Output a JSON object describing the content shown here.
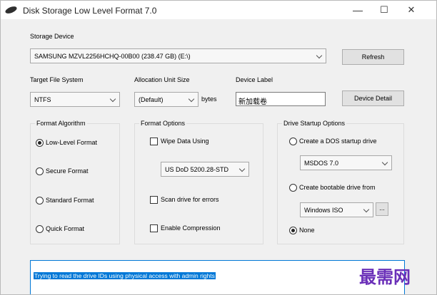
{
  "window": {
    "title": "Disk Storage Low Level Format 7.0",
    "minimize_glyph": "—",
    "maximize_glyph": "☐",
    "close_glyph": "✕",
    "app_icon": "disk-icon"
  },
  "storage": {
    "label": "Storage Device",
    "device_value": "SAMSUNG MZVL2256HCHQ-00B00 (238.47 GB) (E:\\)",
    "refresh_label": "Refresh"
  },
  "target_fs": {
    "label": "Target File System",
    "value": "NTFS"
  },
  "alloc": {
    "label": "Allocation Unit Size",
    "value": "(Default)",
    "unit": "bytes"
  },
  "device_label": {
    "label": "Device Label",
    "value": "新加载卷",
    "detail_button": "Device Detail"
  },
  "format_algorithm": {
    "legend": "Format Algorithm",
    "options": [
      {
        "label": "Low-Level Format",
        "selected": true
      },
      {
        "label": "Secure Format",
        "selected": false
      },
      {
        "label": "Standard Format",
        "selected": false
      },
      {
        "label": "Quick Format",
        "selected": false
      }
    ]
  },
  "format_options": {
    "legend": "Format Options",
    "wipe_label": "Wipe Data Using",
    "wipe_method": "US DoD 5200.28-STD",
    "scan_label": "Scan drive for errors",
    "compression_label": "Enable Compression"
  },
  "startup_options": {
    "legend": "Drive Startup Options",
    "dos_label": "Create a DOS startup drive",
    "dos_value": "MSDOS 7.0",
    "bootable_label": "Create bootable drive from",
    "bootable_value": "Windows ISO",
    "browse_label": "...",
    "none_label": "None",
    "selected": "None"
  },
  "log": {
    "message": "Trying to read the drive IDs using physical access with admin rights"
  },
  "watermark": "最需网",
  "colors": {
    "selection": "#0078d7",
    "watermark": "#6a2fb8"
  }
}
